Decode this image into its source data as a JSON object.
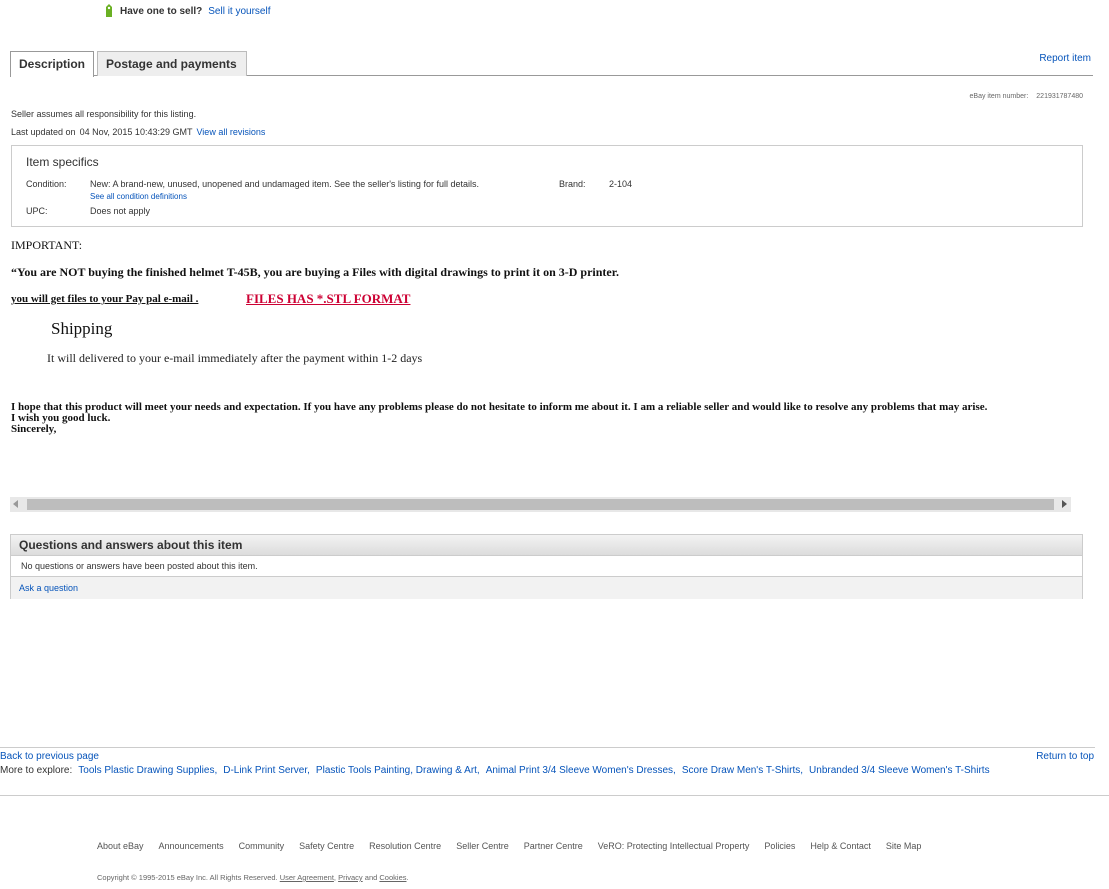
{
  "sell": {
    "question": "Have one to sell?",
    "link": "Sell it yourself"
  },
  "tabs": [
    {
      "label": "Description"
    },
    {
      "label": "Postage and payments"
    }
  ],
  "report_item": "Report item",
  "item_number": {
    "label": "eBay item number:",
    "value": "221931787480"
  },
  "seller_responsibility": "Seller assumes all responsibility for this listing.",
  "last_updated": {
    "label": "Last updated on",
    "date": "04 Nov, 2015 10:43:29 GMT",
    "link": "View all revisions"
  },
  "item_specifics": {
    "title": "Item specifics",
    "condition_label": "Condition:",
    "condition_value": "New: A brand-new, unused, unopened and undamaged item. See the seller's listing for full details.",
    "condition_link": "See all condition definitions",
    "brand_label": "Brand:",
    "brand_value": "2-104",
    "upc_label": "UPC:",
    "upc_value": "Does not apply"
  },
  "description": {
    "important": "IMPORTANT:",
    "not_buying": "“You are NOT buying the finished helmet T-45B, you are buying a Files with digital drawings to print it on 3-D printer.",
    "paypal": "you will get files to your Pay pal e-mail .",
    "format": "FILES HAS *.STL FORMAT",
    "shipping_heading": "Shipping",
    "shipping_text": "It will delivered  to your e-mail immediately after the payment within 1-2 days",
    "closing_1": "I hope that this product will meet your needs and expectation. If you have any problems please do not hesitate to inform me about it. I am a reliable seller and would like to resolve any problems that may arise.",
    "closing_2": "I wish you good luck.",
    "closing_3": "Sincerely,"
  },
  "qa": {
    "title": "Questions and answers about this item",
    "empty": "No questions or answers have been posted about this item.",
    "ask": "Ask a question"
  },
  "nav": {
    "back": "Back to previous page",
    "return_top": "Return to top",
    "explore_label": "More to explore:",
    "explore_links": [
      "Tools Plastic Drawing Supplies,",
      "D-Link Print Server,",
      "Plastic Tools Painting, Drawing & Art,",
      "Animal Print 3/4 Sleeve Women's Dresses,",
      "Score Draw Men's T-Shirts,",
      "Unbranded 3/4 Sleeve Women's T-Shirts"
    ]
  },
  "footer": {
    "links": [
      "About eBay",
      "Announcements",
      "Community",
      "Safety Centre",
      "Resolution Centre",
      "Seller Centre",
      "Partner Centre",
      "VeRO: Protecting Intellectual Property",
      "Policies",
      "Help & Contact",
      "Site Map"
    ],
    "copyright": "Copyright © 1995-2015 eBay Inc. All Rights Reserved.",
    "user_agreement": "User Agreement",
    "privacy": "Privacy",
    "and": "and",
    "cookies": "Cookies"
  },
  "colors": {
    "link": "#0654ba",
    "format_red": "#cc0033",
    "tag_green": "#6ab023"
  }
}
